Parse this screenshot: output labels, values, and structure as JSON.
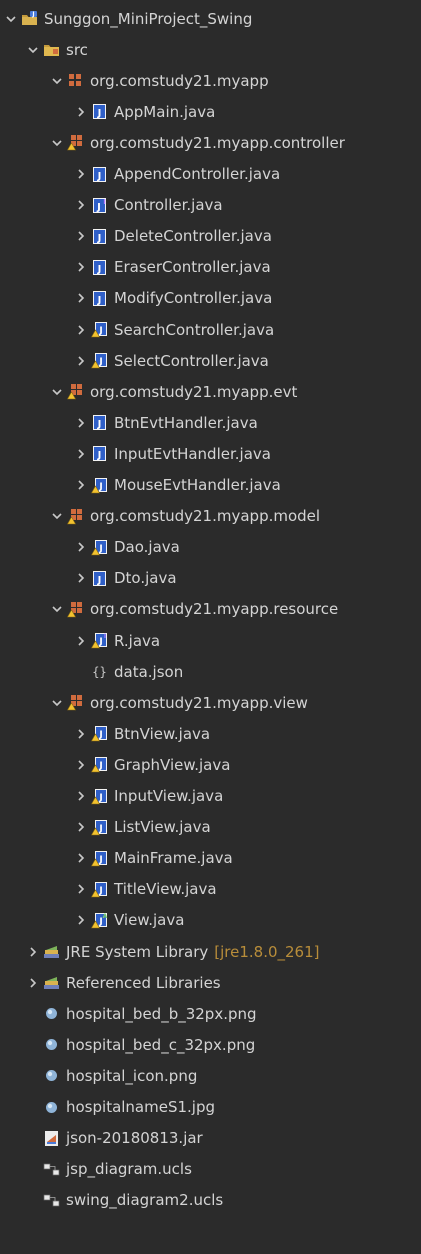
{
  "colors": {
    "background": "#2b2b2b",
    "text": "#d4d4d4",
    "decoration": "#b88d3a",
    "chevron": "#c8c8c8",
    "java_file": "#3b6cd3",
    "package": "#d06b3e"
  },
  "tree": [
    {
      "label": "Sunggon_MiniProject_Swing",
      "icon": "java-project-icon",
      "expanded": true,
      "depth": 0
    },
    {
      "label": "src",
      "icon": "source-folder-icon",
      "expanded": true,
      "depth": 1
    },
    {
      "label": "org.comstudy21.myapp",
      "icon": "package-icon",
      "expanded": true,
      "depth": 2
    },
    {
      "label": "AppMain.java",
      "icon": "java-file-icon",
      "expanded": false,
      "depth": 3
    },
    {
      "label": "org.comstudy21.myapp.controller",
      "icon": "package-warning-icon",
      "expanded": true,
      "depth": 2
    },
    {
      "label": "AppendController.java",
      "icon": "java-file-icon",
      "expanded": false,
      "depth": 3
    },
    {
      "label": "Controller.java",
      "icon": "java-interface-icon",
      "expanded": false,
      "depth": 3
    },
    {
      "label": "DeleteController.java",
      "icon": "java-file-icon",
      "expanded": false,
      "depth": 3
    },
    {
      "label": "EraserController.java",
      "icon": "java-file-icon",
      "expanded": false,
      "depth": 3
    },
    {
      "label": "ModifyController.java",
      "icon": "java-file-icon",
      "expanded": false,
      "depth": 3
    },
    {
      "label": "SearchController.java",
      "icon": "java-file-warning-icon",
      "expanded": false,
      "depth": 3
    },
    {
      "label": "SelectController.java",
      "icon": "java-file-warning-icon",
      "expanded": false,
      "depth": 3
    },
    {
      "label": "org.comstudy21.myapp.evt",
      "icon": "package-warning-icon",
      "expanded": true,
      "depth": 2
    },
    {
      "label": "BtnEvtHandler.java",
      "icon": "java-file-icon",
      "expanded": false,
      "depth": 3
    },
    {
      "label": "InputEvtHandler.java",
      "icon": "java-file-icon",
      "expanded": false,
      "depth": 3
    },
    {
      "label": "MouseEvtHandler.java",
      "icon": "java-file-warning-icon",
      "expanded": false,
      "depth": 3
    },
    {
      "label": "org.comstudy21.myapp.model",
      "icon": "package-warning-icon",
      "expanded": true,
      "depth": 2
    },
    {
      "label": "Dao.java",
      "icon": "java-file-warning-icon",
      "expanded": false,
      "depth": 3
    },
    {
      "label": "Dto.java",
      "icon": "java-file-icon",
      "expanded": false,
      "depth": 3
    },
    {
      "label": "org.comstudy21.myapp.resource",
      "icon": "package-warning-icon",
      "expanded": true,
      "depth": 2
    },
    {
      "label": "R.java",
      "icon": "java-interface-warning-icon",
      "expanded": false,
      "depth": 3
    },
    {
      "label": "data.json",
      "icon": "json-file-icon",
      "leaf": true,
      "depth": 3
    },
    {
      "label": "org.comstudy21.myapp.view",
      "icon": "package-warning-icon",
      "expanded": true,
      "depth": 2
    },
    {
      "label": "BtnView.java",
      "icon": "java-file-warning-icon",
      "expanded": false,
      "depth": 3
    },
    {
      "label": "GraphView.java",
      "icon": "java-file-warning-icon",
      "expanded": false,
      "depth": 3
    },
    {
      "label": "InputView.java",
      "icon": "java-file-warning-icon",
      "expanded": false,
      "depth": 3
    },
    {
      "label": "ListView.java",
      "icon": "java-file-warning-icon",
      "expanded": false,
      "depth": 3
    },
    {
      "label": "MainFrame.java",
      "icon": "java-file-warning-icon",
      "expanded": false,
      "depth": 3
    },
    {
      "label": "TitleView.java",
      "icon": "java-file-warning-icon",
      "expanded": false,
      "depth": 3
    },
    {
      "label": "View.java",
      "icon": "java-abstract-warning-icon",
      "expanded": false,
      "depth": 3
    },
    {
      "label": "JRE System Library",
      "decoration": "[jre1.8.0_261]",
      "icon": "library-icon",
      "expanded": false,
      "depth": 1
    },
    {
      "label": "Referenced Libraries",
      "icon": "library-icon",
      "expanded": false,
      "depth": 1
    },
    {
      "label": "hospital_bed_b_32px.png",
      "icon": "image-file-icon",
      "leaf": true,
      "depth": 1
    },
    {
      "label": "hospital_bed_c_32px.png",
      "icon": "image-file-icon",
      "leaf": true,
      "depth": 1
    },
    {
      "label": "hospital_icon.png",
      "icon": "image-file-icon",
      "leaf": true,
      "depth": 1
    },
    {
      "label": "hospitalnameS1.jpg",
      "icon": "image-file-icon",
      "leaf": true,
      "depth": 1
    },
    {
      "label": "json-20180813.jar",
      "icon": "jar-file-icon",
      "leaf": true,
      "depth": 1
    },
    {
      "label": "jsp_diagram.ucls",
      "icon": "uml-diagram-icon",
      "leaf": true,
      "depth": 1
    },
    {
      "label": "swing_diagram2.ucls",
      "icon": "uml-diagram-icon",
      "leaf": true,
      "depth": 1
    }
  ]
}
